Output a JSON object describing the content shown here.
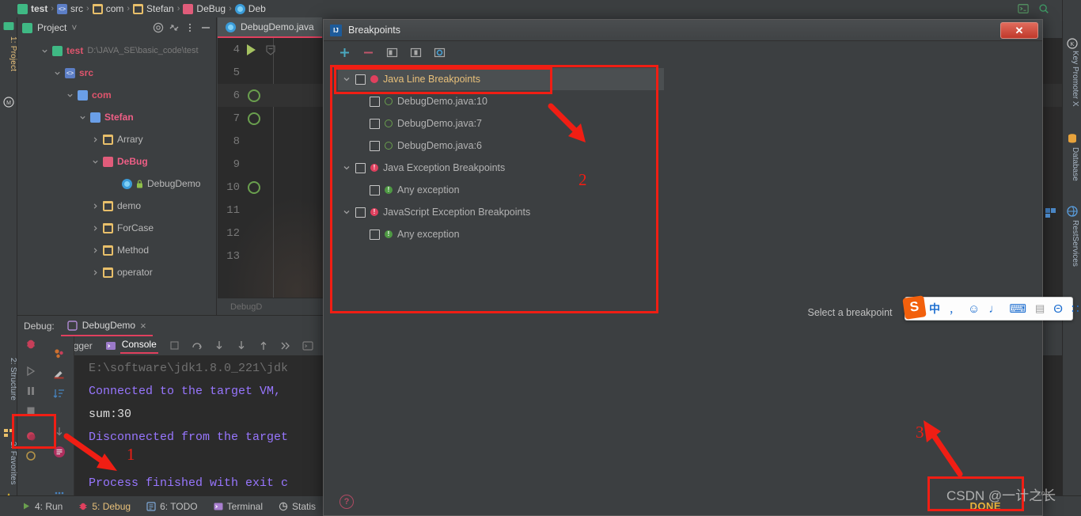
{
  "navbar": {
    "crumbs": [
      {
        "label": "test",
        "icon": "folder-green-icon",
        "bold": true
      },
      {
        "label": "src",
        "icon": "src-folder-icon",
        "bold": false
      },
      {
        "label": "com",
        "icon": "folder-icon",
        "bold": false
      },
      {
        "label": "Stefan",
        "icon": "folder-icon",
        "bold": false
      },
      {
        "label": "DeBug",
        "icon": "package-icon",
        "bold": false
      },
      {
        "label": "Deb",
        "icon": "class-icon",
        "bold": false
      }
    ],
    "separator": "›"
  },
  "left_strip": {
    "tabs": [
      {
        "label": "1: Project",
        "active": true
      },
      {
        "label": "2: Structure",
        "active": false
      },
      {
        "label": "2: Favorites",
        "active": false
      }
    ]
  },
  "right_strip": {
    "tabs": [
      {
        "label": "Key Promoter X"
      },
      {
        "label": "Database"
      },
      {
        "label": "RestServices"
      }
    ],
    "search_icon": "search-icon"
  },
  "project_panel": {
    "title": "Project",
    "chevron": "˅",
    "icons": [
      "target-icon",
      "collapse-all-icon",
      "more-options-icon",
      "hide-icon"
    ],
    "tree": [
      {
        "label": "test",
        "path": "D:\\JAVA_SE\\basic_code\\test",
        "icon": "folder-green-icon",
        "expanded": true,
        "depth": 0,
        "style": "red"
      },
      {
        "label": "src",
        "path": "",
        "icon": "src-folder-icon",
        "expanded": true,
        "depth": 1,
        "style": "red"
      },
      {
        "label": "com",
        "path": "",
        "icon": "folder-blue-icon",
        "expanded": true,
        "depth": 2,
        "style": "red"
      },
      {
        "label": "Stefan",
        "path": "",
        "icon": "folder-blue-icon",
        "expanded": true,
        "depth": 3,
        "style": "pink"
      },
      {
        "label": "Arrary",
        "path": "",
        "icon": "folder-icon",
        "expanded": false,
        "depth": 4,
        "style": "plain"
      },
      {
        "label": "DeBug",
        "path": "",
        "icon": "package-icon",
        "expanded": true,
        "depth": 4,
        "style": "pink"
      },
      {
        "label": "DebugDemo",
        "path": "",
        "icon": "class-lock-icon",
        "expanded": null,
        "depth": 5,
        "style": "plain"
      },
      {
        "label": "demo",
        "path": "",
        "icon": "folder-icon",
        "expanded": false,
        "depth": 4,
        "style": "plain"
      },
      {
        "label": "ForCase",
        "path": "",
        "icon": "folder-icon",
        "expanded": false,
        "depth": 4,
        "style": "plain"
      },
      {
        "label": "Method",
        "path": "",
        "icon": "folder-icon",
        "expanded": false,
        "depth": 4,
        "style": "plain"
      },
      {
        "label": "operator",
        "path": "",
        "icon": "folder-icon",
        "expanded": false,
        "depth": 4,
        "style": "plain"
      }
    ]
  },
  "editor": {
    "tab_label": "DebugDemo.java",
    "tab_icon": "class-icon",
    "status_text": "DebugD",
    "lines": [
      {
        "num": "4",
        "marker": "run",
        "highlight": false
      },
      {
        "num": "5",
        "marker": "none",
        "highlight": false
      },
      {
        "num": "6",
        "marker": "breakpoint",
        "highlight": true
      },
      {
        "num": "7",
        "marker": "breakpoint",
        "highlight": false
      },
      {
        "num": "8",
        "marker": "none",
        "highlight": false
      },
      {
        "num": "9",
        "marker": "none",
        "highlight": false
      },
      {
        "num": "10",
        "marker": "breakpoint",
        "highlight": false
      },
      {
        "num": "11",
        "marker": "none",
        "highlight": false
      },
      {
        "num": "12",
        "marker": "none",
        "highlight": false
      },
      {
        "num": "13",
        "marker": "none",
        "highlight": false
      }
    ]
  },
  "debug_panel": {
    "header_label": "Debug:",
    "session_tab": "DebugDemo",
    "session_close": "×",
    "session_icon": "debug-session-icon",
    "tabs": [
      {
        "label": "Debugger",
        "selected": false,
        "icon": null
      },
      {
        "label": "Console",
        "selected": true,
        "icon": "console-icon"
      }
    ],
    "toolbar_icons": [
      "resume-icon",
      "pause-icon",
      "stop-icon",
      "view-breakpoints-icon",
      "mute-breakpoints-icon",
      "more-icon",
      "evaluate-icon",
      "settings-icon",
      "sort-icon",
      "step-up-icon",
      "step-down-icon",
      "layout-icon",
      "more-icon"
    ],
    "console_lines": [
      {
        "text": "E:\\software\\jdk1.8.0_221\\jdk",
        "color": "gray"
      },
      {
        "text": "Connected to the target VM,",
        "color": "purple"
      },
      {
        "text": "sum:30",
        "color": "white"
      },
      {
        "text": "Disconnected from the target",
        "color": "purple"
      },
      {
        "text": "",
        "color": "purple"
      },
      {
        "text": "Process finished with exit c",
        "color": "purple"
      }
    ]
  },
  "statusbar": {
    "items": [
      {
        "label": "4: Run",
        "icon": "run-icon",
        "accent": false
      },
      {
        "label": "5: Debug",
        "icon": "debug-icon",
        "accent": true
      },
      {
        "label": "6: TODO",
        "icon": "todo-icon",
        "accent": false
      },
      {
        "label": "Terminal",
        "icon": "terminal-icon",
        "accent": false
      },
      {
        "label": "Statis",
        "icon": "statistic-icon",
        "accent": false
      }
    ]
  },
  "dialog": {
    "title": "Breakpoints",
    "logo_text": "IJ",
    "close_label": "✕",
    "toolbar": [
      {
        "name": "add-breakpoint-button",
        "glyph": "+"
      },
      {
        "name": "remove-breakpoint-button",
        "glyph": "−"
      },
      {
        "name": "group-by-file-button",
        "glyph": "▤"
      },
      {
        "name": "group-by-type-button",
        "glyph": "▥"
      },
      {
        "name": "group-by-class-button",
        "glyph": "◉"
      }
    ],
    "tree": [
      {
        "label": "Java Line Breakpoints",
        "indent": false,
        "chevron": true,
        "marker": "red-dot",
        "selected": true
      },
      {
        "label": "DebugDemo.java:10",
        "indent": true,
        "chevron": false,
        "marker": "green-circle",
        "selected": false
      },
      {
        "label": "DebugDemo.java:7",
        "indent": true,
        "chevron": false,
        "marker": "green-circle",
        "selected": false
      },
      {
        "label": "DebugDemo.java:6",
        "indent": true,
        "chevron": false,
        "marker": "green-circle",
        "selected": false
      },
      {
        "label": "Java Exception Breakpoints",
        "indent": false,
        "chevron": true,
        "marker": "red-excl",
        "selected": false
      },
      {
        "label": "Any exception",
        "indent": true,
        "chevron": false,
        "marker": "green-excl",
        "selected": false
      },
      {
        "label": "JavaScript Exception Breakpoints",
        "indent": false,
        "chevron": true,
        "marker": "red-excl",
        "selected": false
      },
      {
        "label": "Any exception",
        "indent": true,
        "chevron": false,
        "marker": "green-excl",
        "selected": false
      }
    ],
    "detail_placeholder": "Select a breakpoint",
    "help_glyph": "?",
    "done_label": "DONE"
  },
  "annotations": {
    "markers": [
      {
        "number": "1"
      },
      {
        "number": "2"
      },
      {
        "number": "3"
      }
    ],
    "color": "#f01e14"
  },
  "ime": {
    "logo": "S",
    "buttons": [
      {
        "name": "chinese-mode-icon",
        "glyph": "中"
      },
      {
        "name": "punctuation-icon",
        "glyph": "，"
      },
      {
        "name": "emoji-icon",
        "glyph": "☺"
      },
      {
        "name": "voice-input-icon",
        "glyph": "♩"
      },
      {
        "name": "soft-keyboard-icon",
        "glyph": "⌨"
      },
      {
        "name": "user-icon",
        "glyph": "▤"
      },
      {
        "name": "skin-icon",
        "glyph": "Θ"
      },
      {
        "name": "toolbox-icon",
        "glyph": "∷"
      }
    ]
  },
  "watermark": {
    "text": "CSDN @一计之长",
    "logo": "Log"
  }
}
